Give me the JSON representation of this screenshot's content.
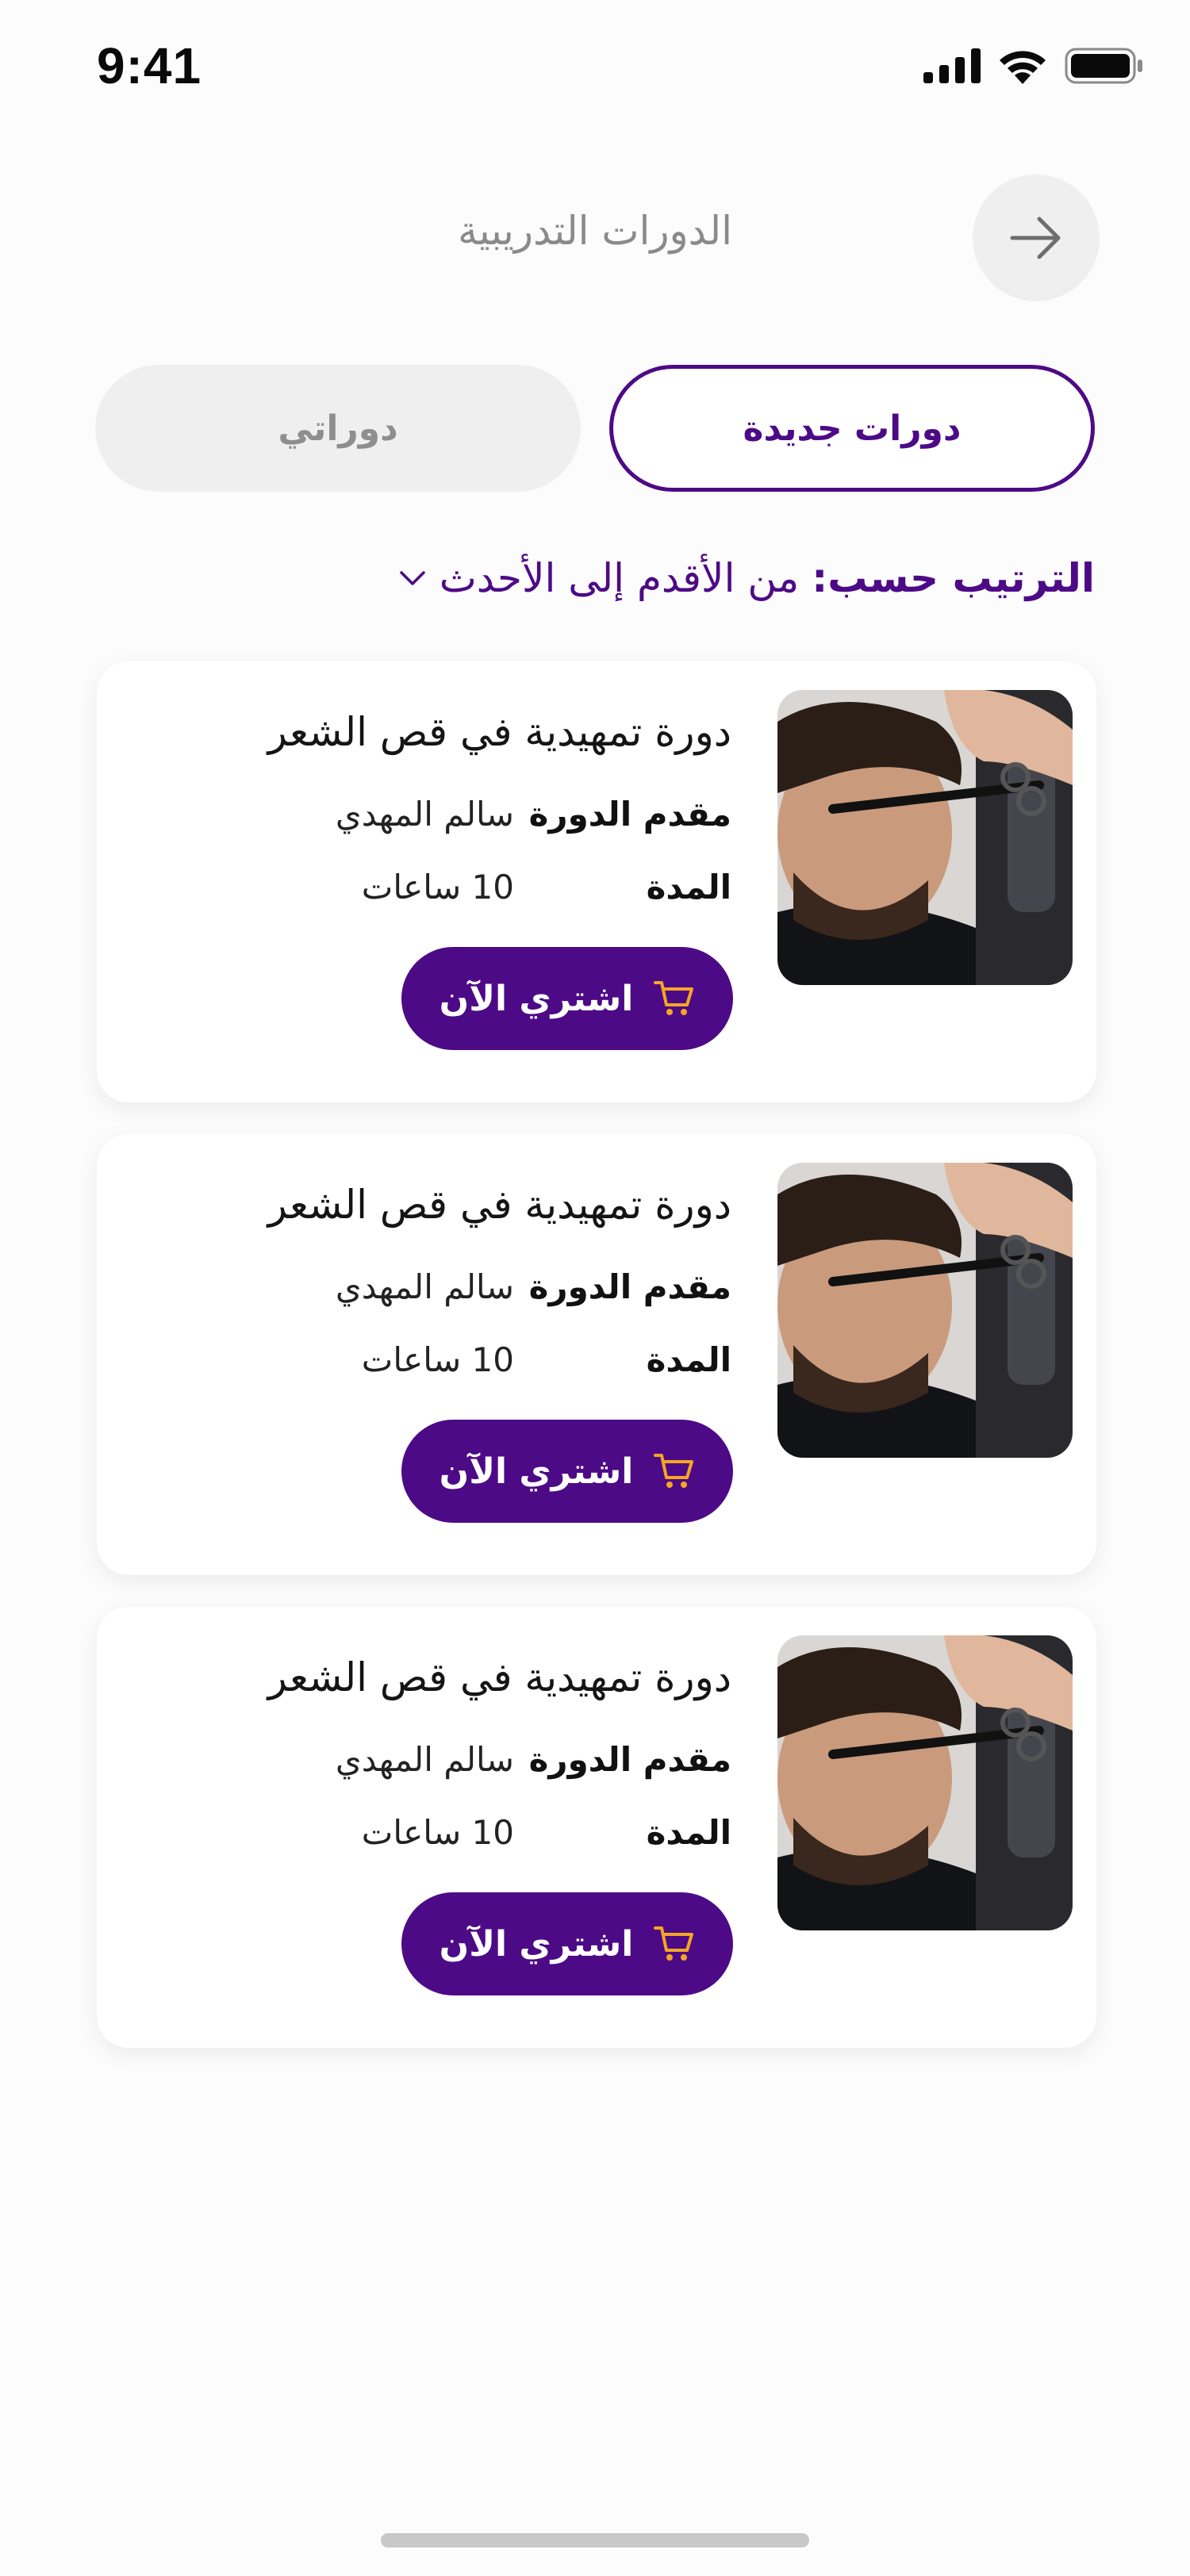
{
  "status_bar": {
    "time": "9:41"
  },
  "header": {
    "title": "الدورات التدريبية"
  },
  "tabs": [
    {
      "label": "دورات جديدة",
      "active": true
    },
    {
      "label": "دوراتي",
      "active": false
    }
  ],
  "sort": {
    "label": "الترتيب حسب:",
    "value": "من الأقدم إلى الأحدث"
  },
  "courses": [
    {
      "title": "دورة تمهيدية في قص الشعر",
      "instructor_label": "مقدم الدورة",
      "instructor": "سالم المهدي",
      "duration_label": "المدة",
      "duration": "10 ساعات",
      "buy_label": "اشتري الآن"
    },
    {
      "title": "دورة تمهيدية في قص الشعر",
      "instructor_label": "مقدم الدورة",
      "instructor": "سالم المهدي",
      "duration_label": "المدة",
      "duration": "10 ساعات",
      "buy_label": "اشتري الآن"
    },
    {
      "title": "دورة تمهيدية في قص الشعر",
      "instructor_label": "مقدم الدورة",
      "instructor": "سالم المهدي",
      "duration_label": "المدة",
      "duration": "10 ساعات",
      "buy_label": "اشتري الآن"
    }
  ],
  "colors": {
    "primary": "#4d0a86",
    "cart_accent": "#f5a623",
    "inactive": "#efefef"
  },
  "icons": {
    "back": "arrow-right-icon",
    "sort": "chevron-down-icon",
    "cart": "cart-icon"
  }
}
